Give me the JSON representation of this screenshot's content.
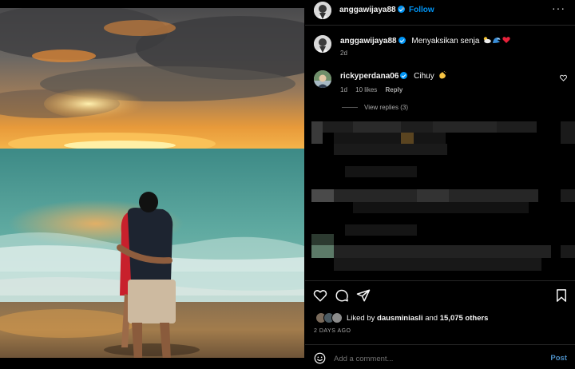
{
  "post": {
    "author": "anggawijaya88",
    "follow_label": "Follow",
    "separator": "•",
    "more_label": "···"
  },
  "caption": {
    "username": "anggawijaya88",
    "text": "Menyaksikan senja",
    "time": "2d"
  },
  "comments": [
    {
      "username": "rickyperdana06",
      "text": "Cihuy",
      "time": "1d",
      "likes": "10 likes",
      "reply_label": "Reply",
      "view_replies": "View replies (3)"
    }
  ],
  "likes": {
    "prefix": "Liked by",
    "user": "dausminiasli",
    "joiner": "and",
    "others": "15,075 others"
  },
  "date": "2 DAYS AGO",
  "comment_bar": {
    "placeholder": "Add a comment...",
    "post_label": "Post"
  },
  "colors": {
    "accent": "#0095f6",
    "background": "#000000",
    "muted": "#a8a8a8"
  },
  "icons": [
    "verified-icon",
    "more-icon",
    "heart-icon",
    "comment-icon",
    "share-icon",
    "bookmark-icon",
    "emoji-icon",
    "cloud-emoji-icon",
    "wave-emoji-icon",
    "red-heart-emoji-icon",
    "clap-emoji-icon"
  ]
}
